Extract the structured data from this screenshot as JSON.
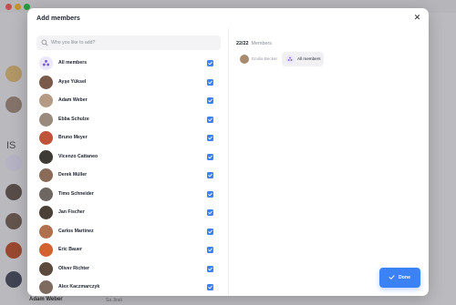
{
  "background": {
    "bottom_name": "Adam Weber",
    "bottom_role": "Sa Jirali",
    "rail_initials": "IS"
  },
  "modal": {
    "title": "Add members",
    "close_icon": "close-icon"
  },
  "search": {
    "placeholder": "Who you like to add?",
    "value": ""
  },
  "members": [
    {
      "name": "All members",
      "checked": true,
      "type": "group",
      "avatar_color": "#ece8fb"
    },
    {
      "name": "Ayşe Yüksel",
      "checked": true,
      "avatar_color": "#7a5a4a"
    },
    {
      "name": "Adam Weber",
      "checked": true,
      "avatar_color": "#b59a86"
    },
    {
      "name": "Ebba Schulze",
      "checked": true,
      "avatar_color": "#9a8a7e"
    },
    {
      "name": "Bruno Meyer",
      "checked": true,
      "avatar_color": "#c0533a"
    },
    {
      "name": "Vicenzo Cattaneo",
      "checked": true,
      "avatar_color": "#3e3a36"
    },
    {
      "name": "Derek Müller",
      "checked": true,
      "avatar_color": "#8a6b58"
    },
    {
      "name": "Timo Schneider",
      "checked": true,
      "avatar_color": "#6e6660"
    },
    {
      "name": "Jan Fischer",
      "checked": true,
      "avatar_color": "#4a4038"
    },
    {
      "name": "Carlos Martinez",
      "checked": true,
      "avatar_color": "#b0704e"
    },
    {
      "name": "Eric Bauer",
      "checked": true,
      "avatar_color": "#d4622e"
    },
    {
      "name": "Oliver Richter",
      "checked": true,
      "avatar_color": "#5c4a3c"
    },
    {
      "name": "Alex Kaczmarczyk",
      "checked": true,
      "avatar_color": "#7e6a5e"
    }
  ],
  "summary": {
    "count": "22/22",
    "label": "Members"
  },
  "chips": [
    {
      "label": "Emilia Becker",
      "avatar_color": "#a88a6e"
    },
    {
      "label": "All members",
      "avatar_color": "#ece8fb"
    }
  ],
  "done_button": {
    "label": "Done"
  },
  "colors": {
    "accent": "#3b82f6",
    "group_icon": "#7c5ce0"
  }
}
